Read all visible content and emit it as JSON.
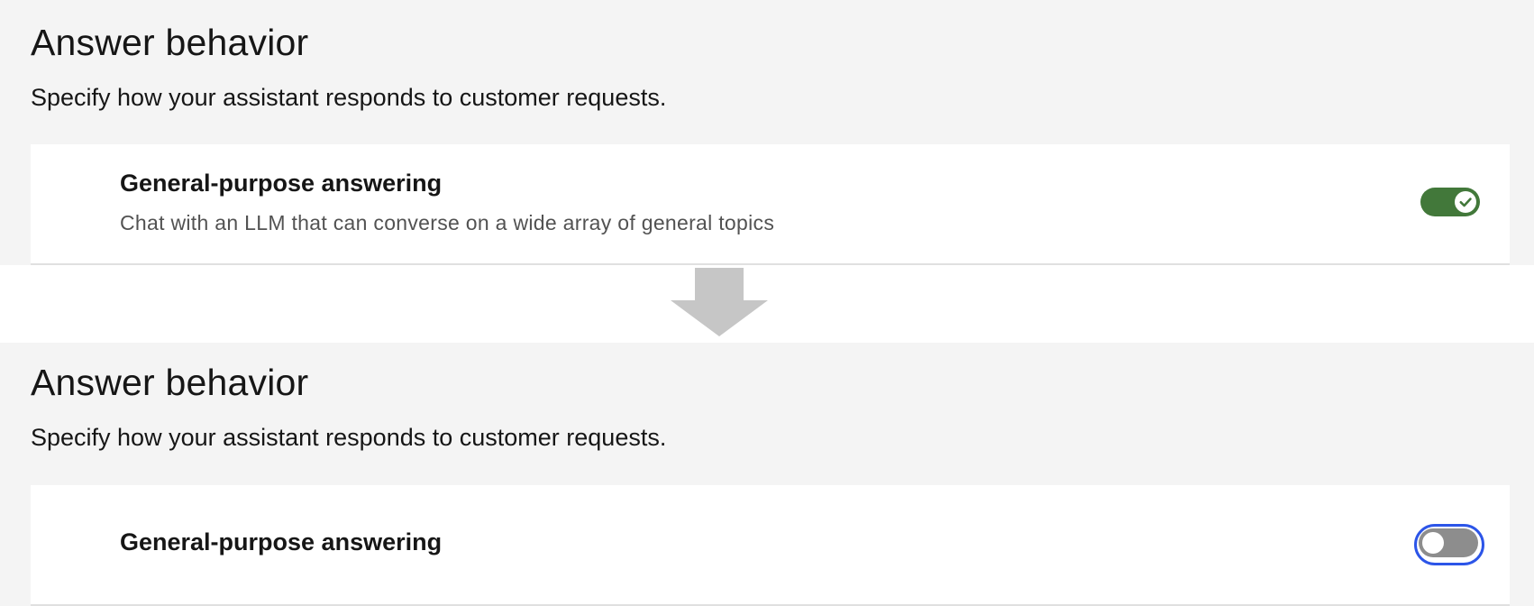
{
  "before": {
    "section_title": "Answer behavior",
    "section_description": "Specify how your assistant responds to customer requests.",
    "feature": {
      "title": "General-purpose answering",
      "description": "Chat with an LLM that can converse on a wide array of general topics",
      "toggle_state": "on",
      "toggle_icon": "checkmark-icon"
    }
  },
  "transition": {
    "icon": "arrow-down-icon",
    "color": "#c6c6c6"
  },
  "after": {
    "section_title": "Answer behavior",
    "section_description": "Specify how your assistant responds to customer requests.",
    "feature": {
      "title": "General-purpose answering",
      "toggle_state": "off",
      "focused": true
    }
  },
  "colors": {
    "panel_background": "#f4f4f4",
    "card_background": "#ffffff",
    "toggle_on": "#42783a",
    "toggle_off": "#8d8d8d",
    "focus_ring": "#2c55e8"
  }
}
